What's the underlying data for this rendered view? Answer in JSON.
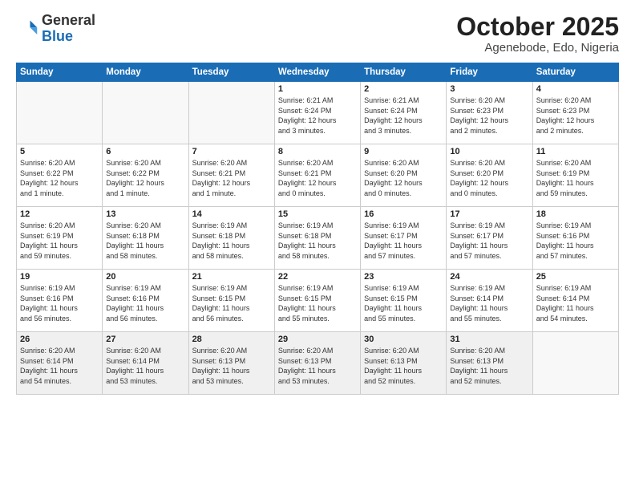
{
  "logo": {
    "general": "General",
    "blue": "Blue"
  },
  "title": "October 2025",
  "subtitle": "Agenebode, Edo, Nigeria",
  "weekdays": [
    "Sunday",
    "Monday",
    "Tuesday",
    "Wednesday",
    "Thursday",
    "Friday",
    "Saturday"
  ],
  "weeks": [
    [
      {
        "day": "",
        "info": ""
      },
      {
        "day": "",
        "info": ""
      },
      {
        "day": "",
        "info": ""
      },
      {
        "day": "1",
        "info": "Sunrise: 6:21 AM\nSunset: 6:24 PM\nDaylight: 12 hours\nand 3 minutes."
      },
      {
        "day": "2",
        "info": "Sunrise: 6:21 AM\nSunset: 6:24 PM\nDaylight: 12 hours\nand 3 minutes."
      },
      {
        "day": "3",
        "info": "Sunrise: 6:20 AM\nSunset: 6:23 PM\nDaylight: 12 hours\nand 2 minutes."
      },
      {
        "day": "4",
        "info": "Sunrise: 6:20 AM\nSunset: 6:23 PM\nDaylight: 12 hours\nand 2 minutes."
      }
    ],
    [
      {
        "day": "5",
        "info": "Sunrise: 6:20 AM\nSunset: 6:22 PM\nDaylight: 12 hours\nand 1 minute."
      },
      {
        "day": "6",
        "info": "Sunrise: 6:20 AM\nSunset: 6:22 PM\nDaylight: 12 hours\nand 1 minute."
      },
      {
        "day": "7",
        "info": "Sunrise: 6:20 AM\nSunset: 6:21 PM\nDaylight: 12 hours\nand 1 minute."
      },
      {
        "day": "8",
        "info": "Sunrise: 6:20 AM\nSunset: 6:21 PM\nDaylight: 12 hours\nand 0 minutes."
      },
      {
        "day": "9",
        "info": "Sunrise: 6:20 AM\nSunset: 6:20 PM\nDaylight: 12 hours\nand 0 minutes."
      },
      {
        "day": "10",
        "info": "Sunrise: 6:20 AM\nSunset: 6:20 PM\nDaylight: 12 hours\nand 0 minutes."
      },
      {
        "day": "11",
        "info": "Sunrise: 6:20 AM\nSunset: 6:19 PM\nDaylight: 11 hours\nand 59 minutes."
      }
    ],
    [
      {
        "day": "12",
        "info": "Sunrise: 6:20 AM\nSunset: 6:19 PM\nDaylight: 11 hours\nand 59 minutes."
      },
      {
        "day": "13",
        "info": "Sunrise: 6:20 AM\nSunset: 6:18 PM\nDaylight: 11 hours\nand 58 minutes."
      },
      {
        "day": "14",
        "info": "Sunrise: 6:19 AM\nSunset: 6:18 PM\nDaylight: 11 hours\nand 58 minutes."
      },
      {
        "day": "15",
        "info": "Sunrise: 6:19 AM\nSunset: 6:18 PM\nDaylight: 11 hours\nand 58 minutes."
      },
      {
        "day": "16",
        "info": "Sunrise: 6:19 AM\nSunset: 6:17 PM\nDaylight: 11 hours\nand 57 minutes."
      },
      {
        "day": "17",
        "info": "Sunrise: 6:19 AM\nSunset: 6:17 PM\nDaylight: 11 hours\nand 57 minutes."
      },
      {
        "day": "18",
        "info": "Sunrise: 6:19 AM\nSunset: 6:16 PM\nDaylight: 11 hours\nand 57 minutes."
      }
    ],
    [
      {
        "day": "19",
        "info": "Sunrise: 6:19 AM\nSunset: 6:16 PM\nDaylight: 11 hours\nand 56 minutes."
      },
      {
        "day": "20",
        "info": "Sunrise: 6:19 AM\nSunset: 6:16 PM\nDaylight: 11 hours\nand 56 minutes."
      },
      {
        "day": "21",
        "info": "Sunrise: 6:19 AM\nSunset: 6:15 PM\nDaylight: 11 hours\nand 56 minutes."
      },
      {
        "day": "22",
        "info": "Sunrise: 6:19 AM\nSunset: 6:15 PM\nDaylight: 11 hours\nand 55 minutes."
      },
      {
        "day": "23",
        "info": "Sunrise: 6:19 AM\nSunset: 6:15 PM\nDaylight: 11 hours\nand 55 minutes."
      },
      {
        "day": "24",
        "info": "Sunrise: 6:19 AM\nSunset: 6:14 PM\nDaylight: 11 hours\nand 55 minutes."
      },
      {
        "day": "25",
        "info": "Sunrise: 6:19 AM\nSunset: 6:14 PM\nDaylight: 11 hours\nand 54 minutes."
      }
    ],
    [
      {
        "day": "26",
        "info": "Sunrise: 6:20 AM\nSunset: 6:14 PM\nDaylight: 11 hours\nand 54 minutes."
      },
      {
        "day": "27",
        "info": "Sunrise: 6:20 AM\nSunset: 6:14 PM\nDaylight: 11 hours\nand 53 minutes."
      },
      {
        "day": "28",
        "info": "Sunrise: 6:20 AM\nSunset: 6:13 PM\nDaylight: 11 hours\nand 53 minutes."
      },
      {
        "day": "29",
        "info": "Sunrise: 6:20 AM\nSunset: 6:13 PM\nDaylight: 11 hours\nand 53 minutes."
      },
      {
        "day": "30",
        "info": "Sunrise: 6:20 AM\nSunset: 6:13 PM\nDaylight: 11 hours\nand 52 minutes."
      },
      {
        "day": "31",
        "info": "Sunrise: 6:20 AM\nSunset: 6:13 PM\nDaylight: 11 hours\nand 52 minutes."
      },
      {
        "day": "",
        "info": ""
      }
    ]
  ]
}
